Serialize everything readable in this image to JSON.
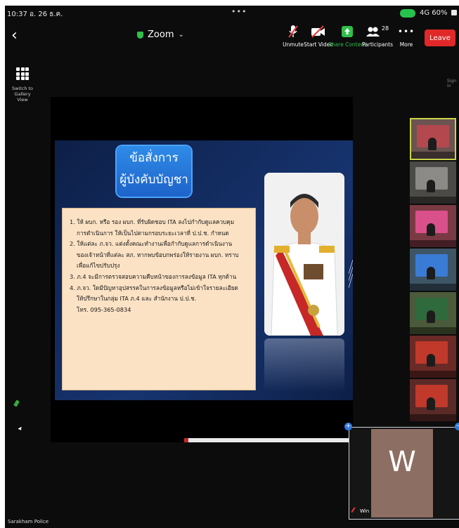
{
  "status_bar": {
    "time": "10:37  อ. 26 ธ.ค.",
    "network": "4G 60%"
  },
  "top_bar": {
    "back_glyph": "‹",
    "meeting_title": "Zoom",
    "buttons": [
      {
        "label": "Unmute",
        "icon": "microphone-muted-icon"
      },
      {
        "label": "Start Video",
        "icon": "video-off-icon"
      },
      {
        "label": "Share Content",
        "icon": "share-arrow-icon"
      },
      {
        "label": "Participants",
        "icon": "participants-icon",
        "badge": "28"
      },
      {
        "label": "More",
        "icon": "ellipsis-icon"
      }
    ],
    "leave_label": "Leave",
    "colors": {
      "share": "#2fbf4a",
      "leave": "#e02828",
      "accent": "#2c7be5"
    }
  },
  "gallery": {
    "label": "Switch to Gallery View"
  },
  "sign_label": "Sign in",
  "slide": {
    "title_line1": "ข้อสั่งการ",
    "title_line2": "ผู้บังคับบัญชา",
    "items": [
      "1. ให้ ผบก. หรือ รอง ผบก. ที่รับผิดชอบ ITA ลงไปกำกับดูแลควบคุม",
      "การดำเนินการ ให้เป็นไปตามกรอบระยะเวลาที่ ป.ป.ช. กำหนด",
      "2. ให้แต่ละ ภ.จว. แต่งตั้งคณะทำงานเพื่อกำกับดูแลการดำเนินงาน",
      "ของเจ้าหน้าที่แต่ละ สภ. หากพบข้อบกพร่องให้รายงาน ผบก. ทราบ",
      "เพื่อแก้ไขปรับปรุง",
      "3. ภ.4 จะมีการตรวจสอบความคืบหน้าของการลงข้อมูล ITA ทุกด้าน",
      "4. ภ.จว. ใดมีปัญหาอุปสรรคในการลงข้อมูลหรือไม่เข้าใจรายละเอียด",
      "ให้ปรึกษาในกลุ่ม ITA ภ.4 และ สำนักงาน ป.ป.ช.",
      "โทร. 095-365-0834"
    ]
  },
  "participant_thumbnails": [
    {
      "color": "#b4484f",
      "bg": "#6b5450"
    },
    {
      "color": "#8c8a86",
      "bg": "#4b4a46"
    },
    {
      "color": "#d9508a",
      "bg": "#7a3a44"
    },
    {
      "color": "#3a7bd5",
      "bg": "#3e5566"
    },
    {
      "color": "#2f6a3c",
      "bg": "#4b5a3a"
    },
    {
      "color": "#c0392b",
      "bg": "#6a2a26"
    },
    {
      "color": "#c0392b",
      "bg": "#5a2a27"
    }
  ],
  "self_view": {
    "initial": "W",
    "name": "Win"
  },
  "bottom_label": "Sarakham Police"
}
